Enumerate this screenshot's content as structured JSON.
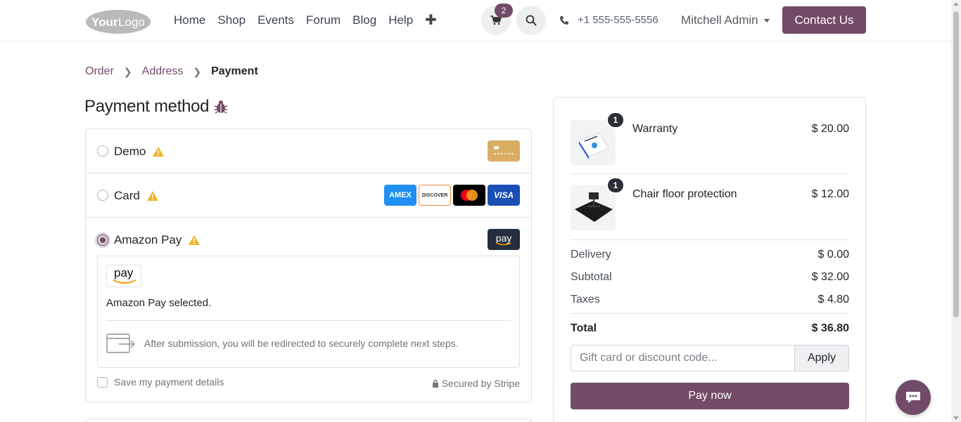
{
  "header": {
    "logo_text": "YourLogo",
    "nav": [
      "Home",
      "Shop",
      "Events",
      "Forum",
      "Blog",
      "Help"
    ],
    "add_icon": "plus-icon",
    "cart_count": "2",
    "phone": "+1 555-555-5556",
    "user_name": "Mitchell Admin",
    "contact_label": "Contact Us"
  },
  "breadcrumb": {
    "order": "Order",
    "address": "Address",
    "payment": "Payment"
  },
  "payment": {
    "title": "Payment method",
    "methods": [
      {
        "label": "Demo",
        "selected": false
      },
      {
        "label": "Card",
        "selected": false
      },
      {
        "label": "Amazon Pay",
        "selected": true
      }
    ],
    "card_brands": [
      "AMEX",
      "DISCOVER",
      "Mastercard",
      "VISA"
    ],
    "amazon_pay_logo_text": "pay",
    "amazon_selected_text": "Amazon Pay selected.",
    "redirect_text": "After submission, you will be redirected to securely complete next steps.",
    "save_details_label": "Save my payment details",
    "secured_label": "Secured by Stripe"
  },
  "summary": {
    "items": [
      {
        "qty": "1",
        "name": "Warranty",
        "price": "$ 20.00"
      },
      {
        "qty": "1",
        "name": "Chair floor protection",
        "price": "$ 12.00"
      }
    ],
    "delivery_label": "Delivery",
    "delivery_value": "$ 0.00",
    "subtotal_label": "Subtotal",
    "subtotal_value": "$ 32.00",
    "taxes_label": "Taxes",
    "taxes_value": "$ 4.80",
    "total_label": "Total",
    "total_value": "$ 36.80",
    "discount_placeholder": "Gift card or discount code...",
    "apply_label": "Apply",
    "pay_now_label": "Pay now"
  },
  "colors": {
    "brand": "#714b67",
    "warning": "#f0b429"
  }
}
